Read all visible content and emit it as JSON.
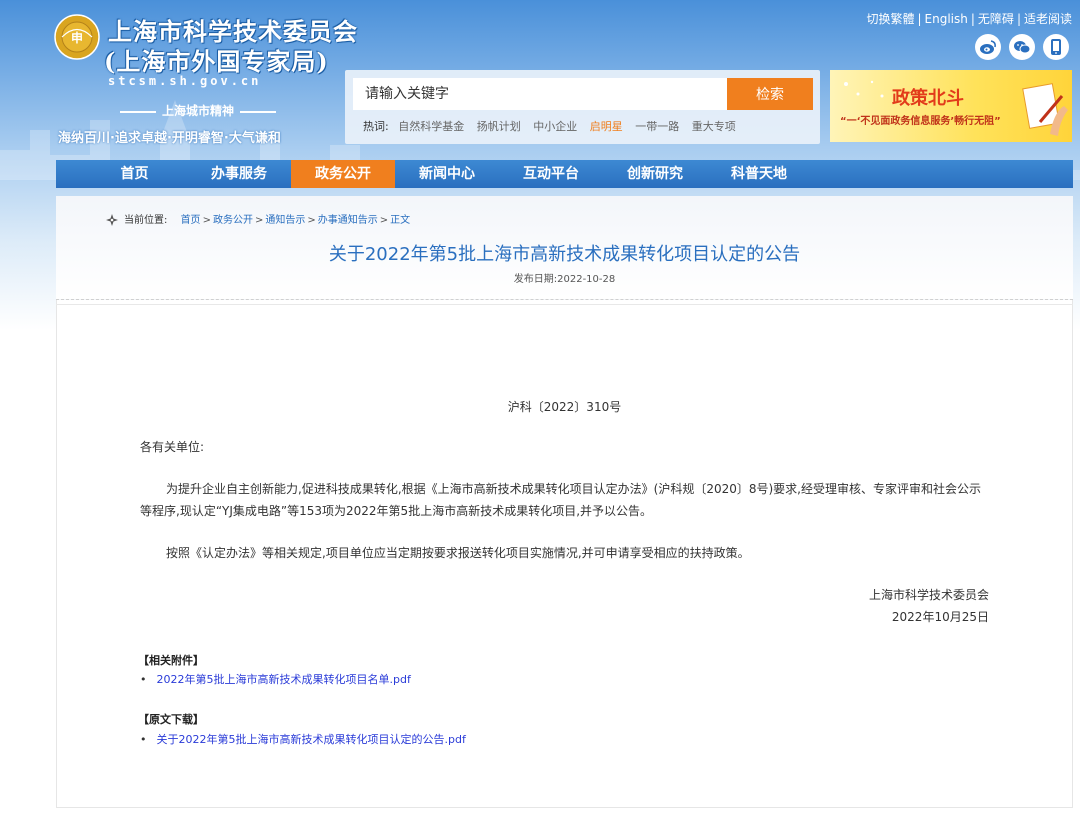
{
  "site": {
    "title_line1": "上海市科学技术委员会",
    "title_line2": "(上海市外国专家局)",
    "url": "stcsm.sh.gov.cn",
    "emblem_text": "申",
    "spirit_title": "上海城市精神",
    "spirit_text": "海纳百川·追求卓越·开明睿智·大气谦和"
  },
  "top_links": {
    "traditional": "切换繁體",
    "english": "English",
    "accessible": "无障碍",
    "elderly": "适老阅读",
    "separator": "|"
  },
  "social": [
    {
      "name": "weibo-icon"
    },
    {
      "name": "wechat-icon"
    },
    {
      "name": "mobile-icon"
    }
  ],
  "search": {
    "placeholder": "请输入关键字",
    "button": "检索",
    "hot_label": "热词:",
    "hot_words": [
      "自然科学基金",
      "扬帆计划",
      "中小企业",
      "启明星",
      "一带一路",
      "重大专项"
    ],
    "highlight_color": "#f07f1e"
  },
  "banner": {
    "title": "政策北斗",
    "subtitle": "“一‘不见面政务信息服务’畅行无阻”"
  },
  "nav": {
    "items": [
      "首页",
      "办事服务",
      "政务公开",
      "新闻中心",
      "互动平台",
      "创新研究",
      "科普天地"
    ],
    "active_index": 2,
    "bar_color": "#2a6fbf",
    "active_color": "#f07f1e"
  },
  "breadcrumb": {
    "label": "当前位置:",
    "items": [
      "首页",
      "政务公开",
      "通知告示",
      "办事通知告示",
      "正文"
    ]
  },
  "article": {
    "title": "关于2022年第5批上海市高新技术成果转化项目认定的公告",
    "publish_date": "发布日期:2022-10-28",
    "doc_number": "沪科〔2022〕310号",
    "greeting": "各有关单位:",
    "paragraphs": [
      "为提升企业自主创新能力,促进科技成果转化,根据《上海市高新技术成果转化项目认定办法》(沪科规〔2020〕8号)要求,经受理审核、专家评审和社会公示等程序,现认定“YJ集成电路”等153项为2022年第5批上海市高新技术成果转化项目,并予以公告。",
      "按照《认定办法》等相关规定,项目单位应当定期按要求报送转化项目实施情况,并可申请享受相应的扶持政策。"
    ],
    "signature_org": "上海市科学技术委员会",
    "signature_date": "2022年10月25日",
    "attachments_heading": "【相关附件】",
    "attachments": [
      "2022年第5批上海市高新技术成果转化项目名单.pdf"
    ],
    "download_heading": "【原文下载】",
    "downloads": [
      "关于2022年第5批上海市高新技术成果转化项目认定的公告.pdf"
    ]
  }
}
